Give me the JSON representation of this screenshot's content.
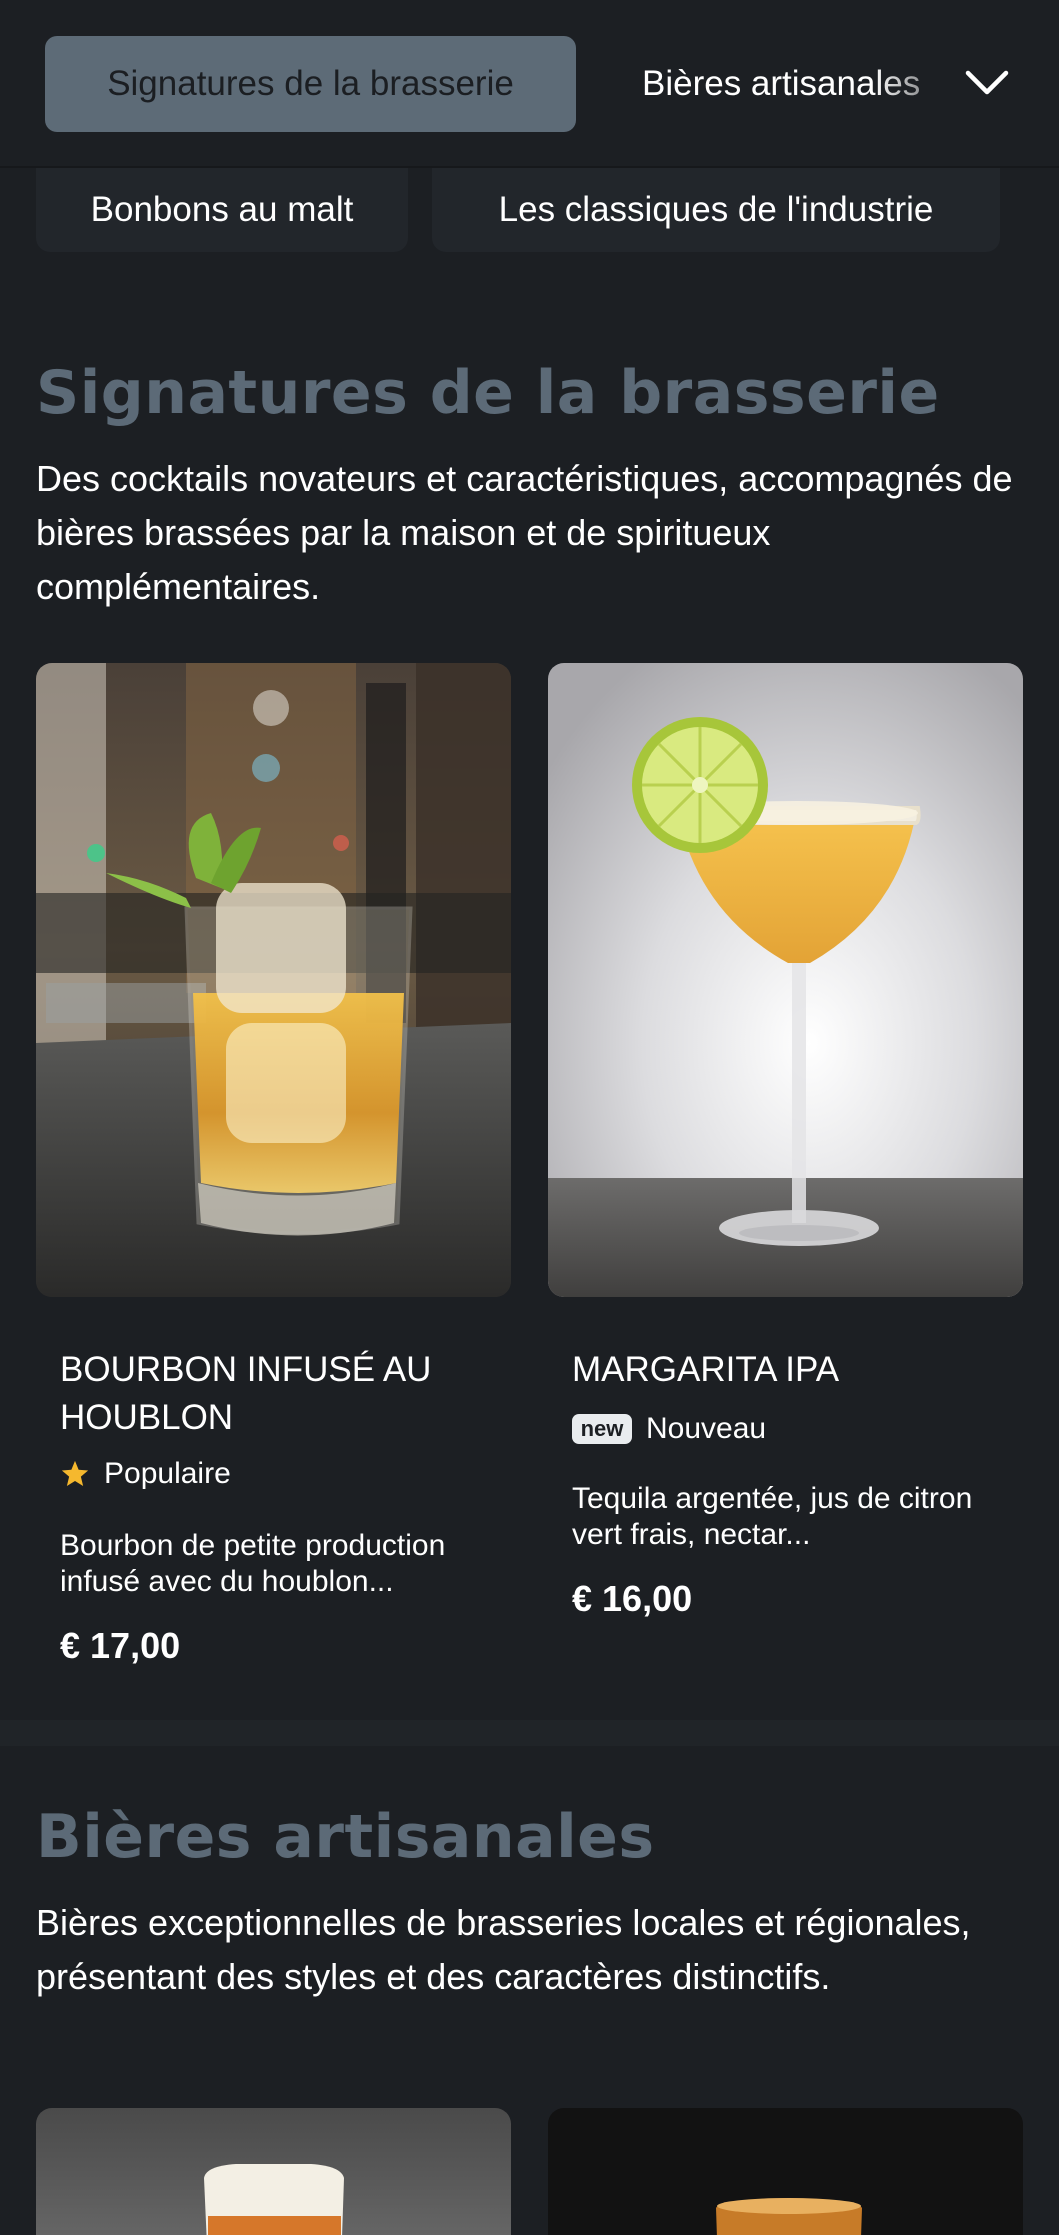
{
  "nav": {
    "active_category": "Signatures de la brasserie",
    "next_category": "Bières artisanales",
    "row2": [
      "Bonbons au malt",
      "Les classiques de l'industrie"
    ]
  },
  "sections": [
    {
      "title": "Signatures de la brasserie",
      "description": "Des cocktails novateurs et caractéristiques, accompagnés de bières brassées par la maison et de spiritueux complémentaires.",
      "items": [
        {
          "name": "BOURBON INFUSÉ AU HOUBLON",
          "badge_label": "Populaire",
          "badge_icon": "star-icon",
          "description": "Bourbon de petite production infusé avec du houblon...",
          "price": "€ 17,00"
        },
        {
          "name": "MARGARITA IPA",
          "badge_label": "Nouveau",
          "badge_icon": "new-icon",
          "badge_tag": "new",
          "description": "Tequila argentée, jus de citron vert frais, nectar...",
          "price": "€ 16,00"
        }
      ]
    },
    {
      "title": "Bières artisanales",
      "description": "Bières exceptionnelles de brasseries locales et régionales, présentant des styles et des caractères distinctifs."
    }
  ],
  "colors": {
    "background": "#1c1f23",
    "active_chip": "#5d6b77",
    "section_title": "#5c6a77",
    "star": "#f5b82e"
  }
}
